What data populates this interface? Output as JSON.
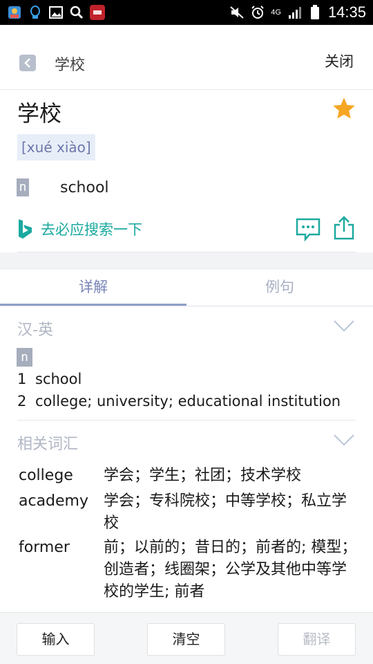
{
  "status_bar": {
    "time": "14:35",
    "network": "4G",
    "icons": [
      "app-icon",
      "qq-icon",
      "image-icon",
      "search-icon",
      "youdao-icon",
      "mute-icon",
      "alarm-icon",
      "signal-icon",
      "battery-icon"
    ]
  },
  "header": {
    "title": "学校",
    "close_label": "关闭"
  },
  "entry": {
    "word": "学校",
    "pinyin": "[xué xiào]",
    "pos": "n",
    "definition": "school",
    "favorited": true,
    "bing_search_label": "去必应搜索一下"
  },
  "tabs": [
    {
      "label": "详解",
      "active": true
    },
    {
      "label": "例句",
      "active": false
    }
  ],
  "chinese_english": {
    "heading": "汉-英",
    "pos": "n",
    "senses": [
      {
        "num": "1",
        "text": "school"
      },
      {
        "num": "2",
        "text": "college; university; educational institution"
      }
    ]
  },
  "related": {
    "heading": "相关词汇",
    "items": [
      {
        "word": "college",
        "definition": "学会；学生；社团；技术学校"
      },
      {
        "word": "academy",
        "definition": "学会；专科院校；中等学校；私立学校"
      },
      {
        "word": "former",
        "definition": "前；以前的；昔日的；前者的; 模型；创造者；线圈架；公学及其他中等学校的学生; 前者"
      }
    ]
  },
  "bottom_bar": {
    "input_label": "输入",
    "clear_label": "清空",
    "translate_label": "翻译"
  },
  "colors": {
    "accent_teal": "#1ba9a0",
    "star": "#f5a623",
    "tab_active": "#7a86b8",
    "pos_tag": "#a6adbd"
  }
}
